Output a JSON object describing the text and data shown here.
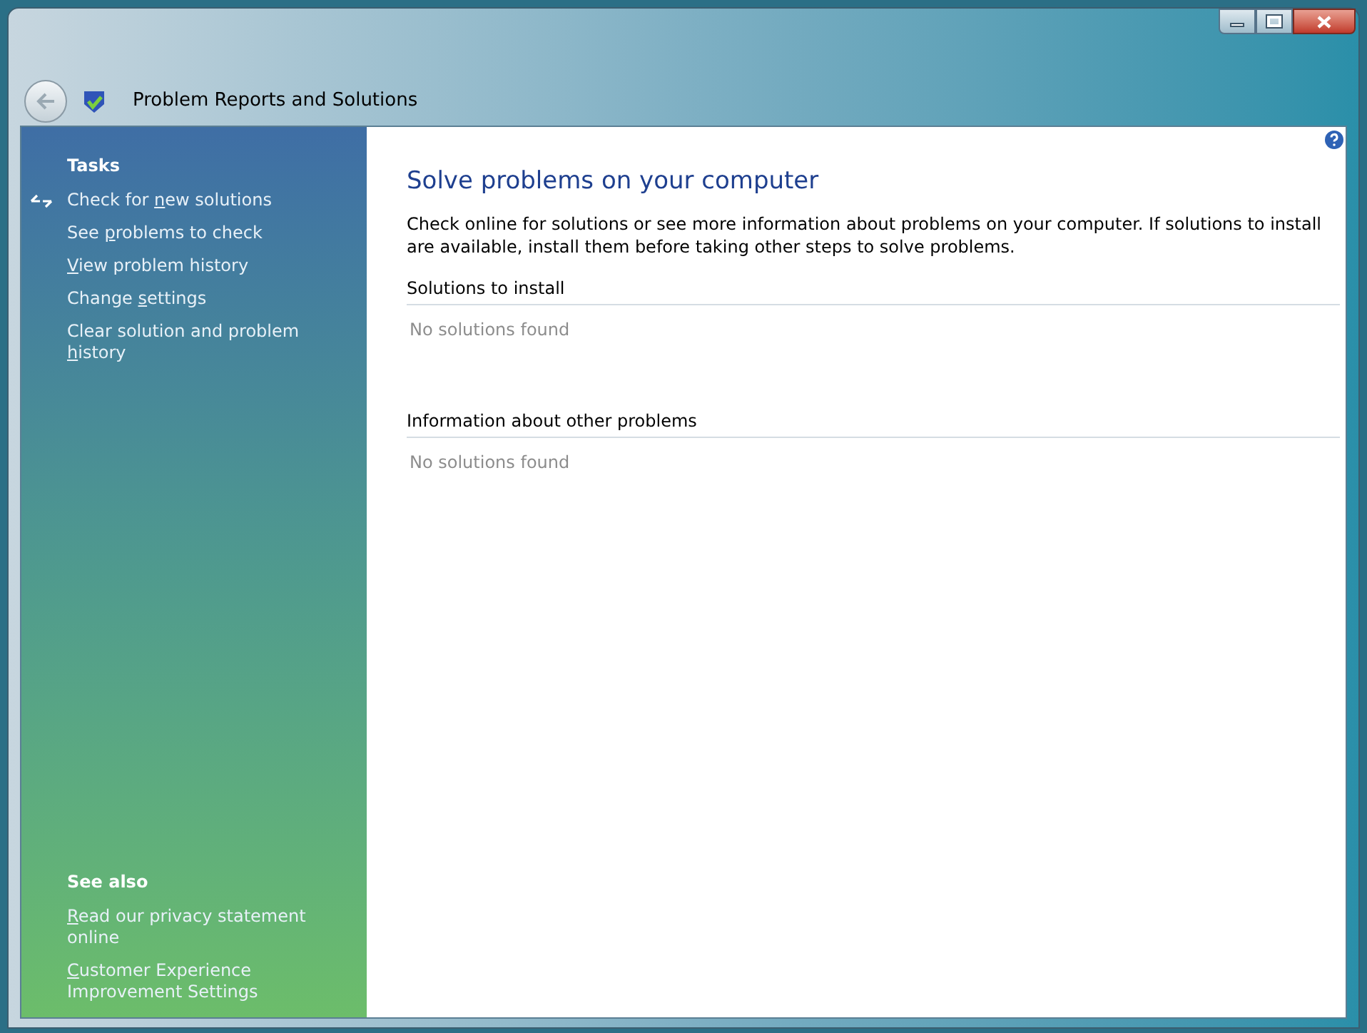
{
  "window": {
    "title": "Problem Reports and Solutions"
  },
  "sidebar": {
    "tasks_heading": "Tasks",
    "tasks": [
      {
        "parts": [
          "Check for ",
          "n",
          "ew solutions"
        ],
        "icon": true
      },
      {
        "parts": [
          "See ",
          "p",
          "roblems to check"
        ],
        "icon": false
      },
      {
        "parts": [
          "V",
          "iew problem history"
        ],
        "key_first": true,
        "icon": false
      },
      {
        "parts": [
          "Change ",
          "s",
          "ettings"
        ],
        "icon": false
      },
      {
        "parts": [
          "Clear solution and problem ",
          "h",
          "istory"
        ],
        "icon": false
      }
    ],
    "see_also_heading": "See also",
    "see_also": [
      {
        "parts": [
          "R",
          "ead our privacy statement online"
        ],
        "key_first": true
      },
      {
        "parts": [
          "C",
          "ustomer Experience Improvement Settings"
        ],
        "key_first": true
      }
    ]
  },
  "content": {
    "title": "Solve problems on your computer",
    "description": "Check online for solutions or see more information about problems on your computer. If solutions to install are available, install them before taking other steps to solve problems.",
    "sections": [
      {
        "heading": "Solutions to install",
        "empty_text": "No solutions found"
      },
      {
        "heading": "Information about other problems",
        "empty_text": "No solutions found"
      }
    ]
  }
}
